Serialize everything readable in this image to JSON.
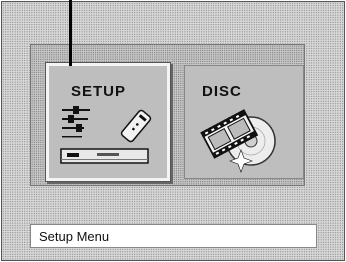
{
  "menu": {
    "items": [
      {
        "label": "SETUP",
        "icon": "setup-settings-icon",
        "selected": true
      },
      {
        "label": "DISC",
        "icon": "disc-film-icon",
        "selected": false
      }
    ]
  },
  "status": {
    "text": "Setup Menu"
  },
  "colors": {
    "highlight_border": "#f4f4f4",
    "text": "#111111"
  }
}
